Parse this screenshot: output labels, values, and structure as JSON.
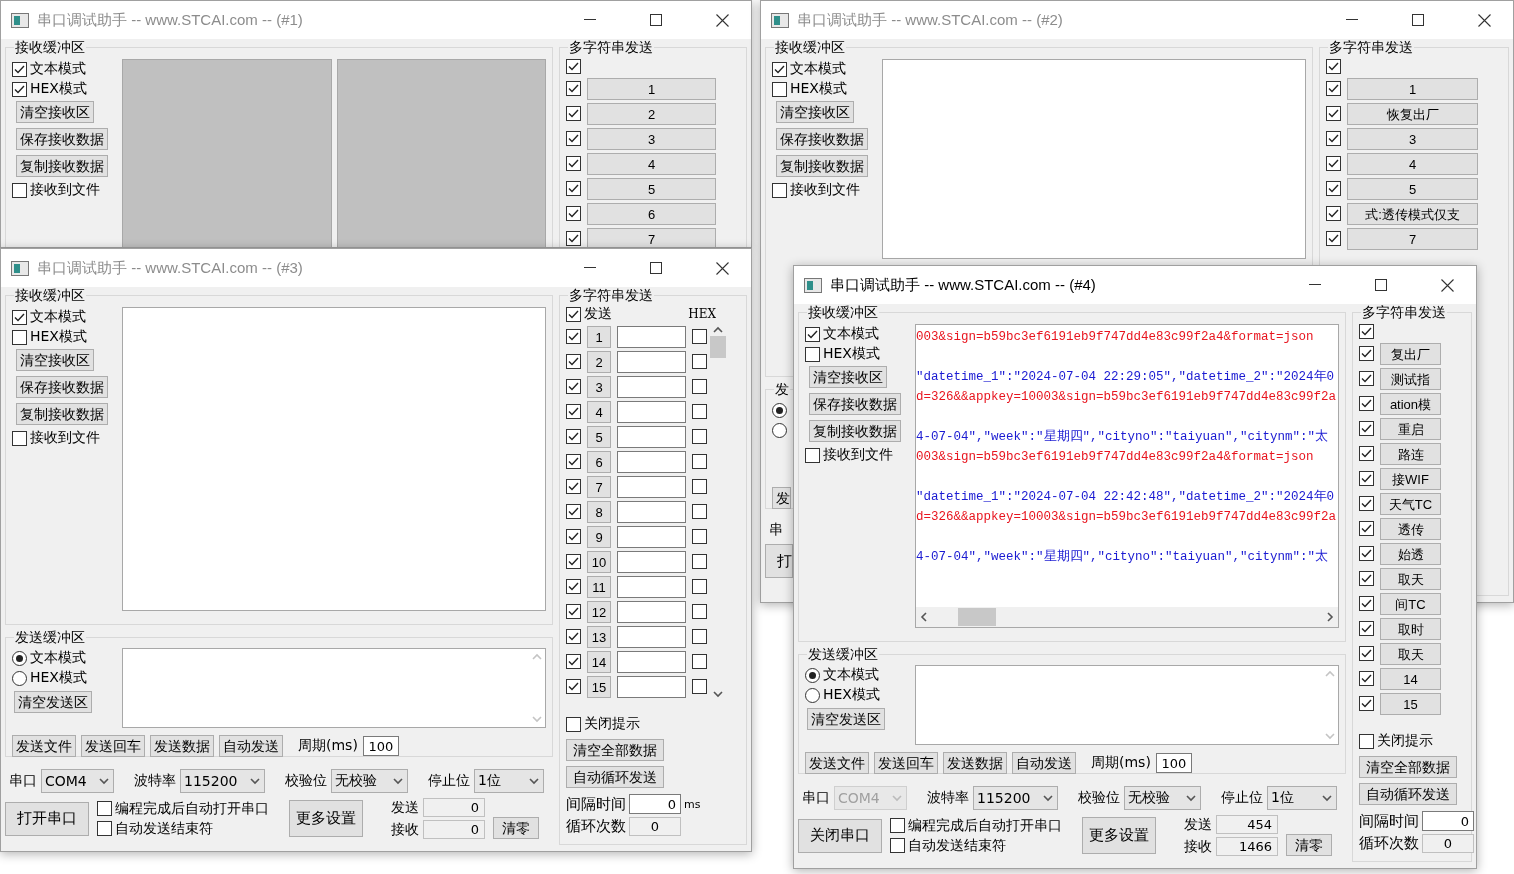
{
  "windows": [
    {
      "title": "串口调试助手 -- www.STCAI.com -- (#1)",
      "active": false,
      "receive": {
        "label": "接收缓冲区",
        "options": [
          {
            "label": "文本模式",
            "checked": true
          },
          {
            "label": "HEX模式",
            "checked": true
          }
        ],
        "buttons": [
          "清空接收区",
          "保存接收数据",
          "复制接收数据"
        ],
        "to_file": {
          "label": "接收到文件",
          "checked": false
        },
        "display": {
          "kind": "split"
        }
      },
      "multi": {
        "label": "多字符串发送",
        "kind": "buttons",
        "all": {
          "checked": true
        },
        "rows": [
          {
            "label": "1",
            "checked": true
          },
          {
            "label": "2",
            "checked": true
          },
          {
            "label": "3",
            "checked": true
          },
          {
            "label": "4",
            "checked": true
          },
          {
            "label": "5",
            "checked": true
          },
          {
            "label": "6",
            "checked": true
          },
          {
            "label": "7",
            "checked": true
          }
        ]
      }
    },
    {
      "title": "串口调试助手 -- www.STCAI.com -- (#2)",
      "active": false,
      "receive": {
        "label": "接收缓冲区",
        "options": [
          {
            "label": "文本模式",
            "checked": true
          },
          {
            "label": "HEX模式",
            "checked": false
          }
        ],
        "buttons": [
          "清空接收区",
          "保存接收数据",
          "复制接收数据"
        ],
        "to_file": {
          "label": "接收到文件",
          "checked": false
        },
        "display": {
          "kind": "text"
        }
      },
      "send": {
        "label": "发",
        "modes": [
          {
            "selected": true
          },
          {
            "selected": false
          }
        ],
        "buttons": [
          "发"
        ]
      },
      "port": {
        "fields": [
          {
            "label": "串"
          }
        ],
        "open_button": "打"
      },
      "multi": {
        "label": "多字符串发送",
        "kind": "buttons",
        "all": {
          "checked": true
        },
        "rows": [
          {
            "label": "1",
            "checked": true
          },
          {
            "label": "恢复出厂",
            "checked": true
          },
          {
            "label": "3",
            "checked": true
          },
          {
            "label": "4",
            "checked": true
          },
          {
            "label": "5",
            "checked": true
          },
          {
            "label": "式:透传模式仅支",
            "checked": true
          },
          {
            "label": "7",
            "checked": true
          }
        ]
      }
    },
    {
      "title": "串口调试助手 -- www.STCAI.com -- (#3)",
      "active": false,
      "receive": {
        "label": "接收缓冲区",
        "options": [
          {
            "label": "文本模式",
            "checked": true
          },
          {
            "label": "HEX模式",
            "checked": false
          }
        ],
        "buttons": [
          "清空接收区",
          "保存接收数据",
          "复制接收数据"
        ],
        "to_file": {
          "label": "接收到文件",
          "checked": false
        },
        "display": {
          "kind": "text"
        }
      },
      "send": {
        "label": "发送缓冲区",
        "modes": [
          {
            "label": "文本模式",
            "selected": true
          },
          {
            "label": "HEX模式",
            "selected": false
          }
        ],
        "clear": "清空发送区",
        "buttons": [
          "发送文件",
          "发送回车",
          "发送数据",
          "自动发送"
        ],
        "period": {
          "label": "周期(ms)",
          "value": "100"
        }
      },
      "port": {
        "fields": [
          {
            "label": "串口",
            "value": "COM4",
            "disabled": false
          },
          {
            "label": "波特率",
            "value": "115200",
            "disabled": false
          },
          {
            "label": "校验位",
            "value": "无校验",
            "disabled": false
          },
          {
            "label": "停止位",
            "value": "1位",
            "disabled": false
          }
        ],
        "open_button": "打开串口",
        "options": [
          {
            "label": "编程完成后自动打开串口",
            "checked": false
          },
          {
            "label": "自动发送结束符",
            "checked": false
          }
        ],
        "more_button": "更多设置",
        "counters": [
          {
            "label": "发送",
            "value": "0"
          },
          {
            "label": "接收",
            "value": "0"
          }
        ],
        "clear_button": "清零"
      },
      "multi": {
        "label": "多字符串发送",
        "kind": "editable",
        "all": {
          "checked": true,
          "label": "发送"
        },
        "hex_label": "HEX",
        "rows": [
          {
            "label": "1",
            "checked": true,
            "hex": false
          },
          {
            "label": "2",
            "checked": true,
            "hex": false
          },
          {
            "label": "3",
            "checked": true,
            "hex": false
          },
          {
            "label": "4",
            "checked": true,
            "hex": false
          },
          {
            "label": "5",
            "checked": true,
            "hex": false
          },
          {
            "label": "6",
            "checked": true,
            "hex": false
          },
          {
            "label": "7",
            "checked": true,
            "hex": false
          },
          {
            "label": "8",
            "checked": true,
            "hex": false
          },
          {
            "label": "9",
            "checked": true,
            "hex": false
          },
          {
            "label": "10",
            "checked": true,
            "hex": false
          },
          {
            "label": "11",
            "checked": true,
            "hex": false
          },
          {
            "label": "12",
            "checked": true,
            "hex": false
          },
          {
            "label": "13",
            "checked": true,
            "hex": false
          },
          {
            "label": "14",
            "checked": true,
            "hex": false
          },
          {
            "label": "15",
            "checked": true,
            "hex": false
          }
        ],
        "close_tip": {
          "label": "关闭提示",
          "checked": false
        },
        "buttons": [
          "清空全部数据",
          "自动循环发送"
        ],
        "interval": {
          "label": "间隔时间",
          "value": "0",
          "unit": "ms"
        },
        "loop": {
          "label": "循环次数",
          "value": "0"
        }
      }
    },
    {
      "title": "串口调试助手 -- www.STCAI.com -- (#4)",
      "active": true,
      "receive": {
        "label": "接收缓冲区",
        "options": [
          {
            "label": "文本模式",
            "checked": true
          },
          {
            "label": "HEX模式",
            "checked": false
          }
        ],
        "buttons": [
          "清空接收区",
          "保存接收数据",
          "复制接收数据"
        ],
        "to_file": {
          "label": "接收到文件",
          "checked": false
        },
        "display": {
          "kind": "log",
          "lines": [
            {
              "text": "003&sign=b59bc3ef6191eb9f747dd4e83c99f2a4&format=json",
              "color": "#e8141e",
              "blank_before": false
            },
            {
              "text": "\"datetime_1\":\"2024-07-04 22:29:05\",\"datetime_2\":\"2024年0",
              "color": "#1a1ad2",
              "blank_before": true
            },
            {
              "text": "d=326&&appkey=10003&sign=b59bc3ef6191eb9f747dd4e83c99f2a",
              "color": "#e8141e",
              "blank_before": false
            },
            {
              "text": "4-07-04\",\"week\":\"星期四\",\"cityno\":\"taiyuan\",\"citynm\":\"太",
              "color": "#1a1ad2",
              "blank_before": true
            },
            {
              "text": "003&sign=b59bc3ef6191eb9f747dd4e83c99f2a4&format=json",
              "color": "#e8141e",
              "blank_before": false
            },
            {
              "text": "\"datetime_1\":\"2024-07-04 22:42:48\",\"datetime_2\":\"2024年0",
              "color": "#1a1ad2",
              "blank_before": true
            },
            {
              "text": "d=326&&appkey=10003&sign=b59bc3ef6191eb9f747dd4e83c99f2a",
              "color": "#e8141e",
              "blank_before": false
            },
            {
              "text": "4-07-04\",\"week\":\"星期四\",\"cityno\":\"taiyuan\",\"citynm\":\"太",
              "color": "#1a1ad2",
              "blank_before": true
            }
          ]
        }
      },
      "send": {
        "label": "发送缓冲区",
        "modes": [
          {
            "label": "文本模式",
            "selected": true
          },
          {
            "label": "HEX模式",
            "selected": false
          }
        ],
        "clear": "清空发送区",
        "buttons": [
          "发送文件",
          "发送回车",
          "发送数据",
          "自动发送"
        ],
        "period": {
          "label": "周期(ms)",
          "value": "100"
        }
      },
      "port": {
        "fields": [
          {
            "label": "串口",
            "value": "COM4",
            "disabled": true
          },
          {
            "label": "波特率",
            "value": "115200",
            "disabled": false
          },
          {
            "label": "校验位",
            "value": "无校验",
            "disabled": false
          },
          {
            "label": "停止位",
            "value": "1位",
            "disabled": false
          }
        ],
        "open_button": "关闭串口",
        "options": [
          {
            "label": "编程完成后自动打开串口",
            "checked": false
          },
          {
            "label": "自动发送结束符",
            "checked": false
          }
        ],
        "more_button": "更多设置",
        "counters": [
          {
            "label": "发送",
            "value": "454"
          },
          {
            "label": "接收",
            "value": "1466"
          }
        ],
        "clear_button": "清零"
      },
      "multi": {
        "label": "多字符串发送",
        "kind": "buttons",
        "all": {
          "checked": true
        },
        "rows": [
          {
            "label": "复出厂",
            "checked": true
          },
          {
            "label": "测试指",
            "checked": true
          },
          {
            "label": "ation模",
            "checked": true
          },
          {
            "label": "重启",
            "checked": true
          },
          {
            "label": "路连",
            "checked": true
          },
          {
            "label": "接WIF",
            "checked": true
          },
          {
            "label": "天气TC",
            "checked": true
          },
          {
            "label": "透传",
            "checked": true
          },
          {
            "label": "始透",
            "checked": true
          },
          {
            "label": "取天",
            "checked": true
          },
          {
            "label": "间TC",
            "checked": true
          },
          {
            "label": "取时",
            "checked": true
          },
          {
            "label": "取天",
            "checked": true
          },
          {
            "label": "14",
            "checked": true
          },
          {
            "label": "15",
            "checked": true
          }
        ],
        "close_tip": {
          "label": "关闭提示",
          "checked": false
        },
        "buttons": [
          "清空全部数据",
          "自动循环发送"
        ],
        "interval": {
          "label": "间隔时间",
          "value": "0"
        },
        "loop": {
          "label": "循环次数",
          "value": "0"
        }
      }
    }
  ]
}
